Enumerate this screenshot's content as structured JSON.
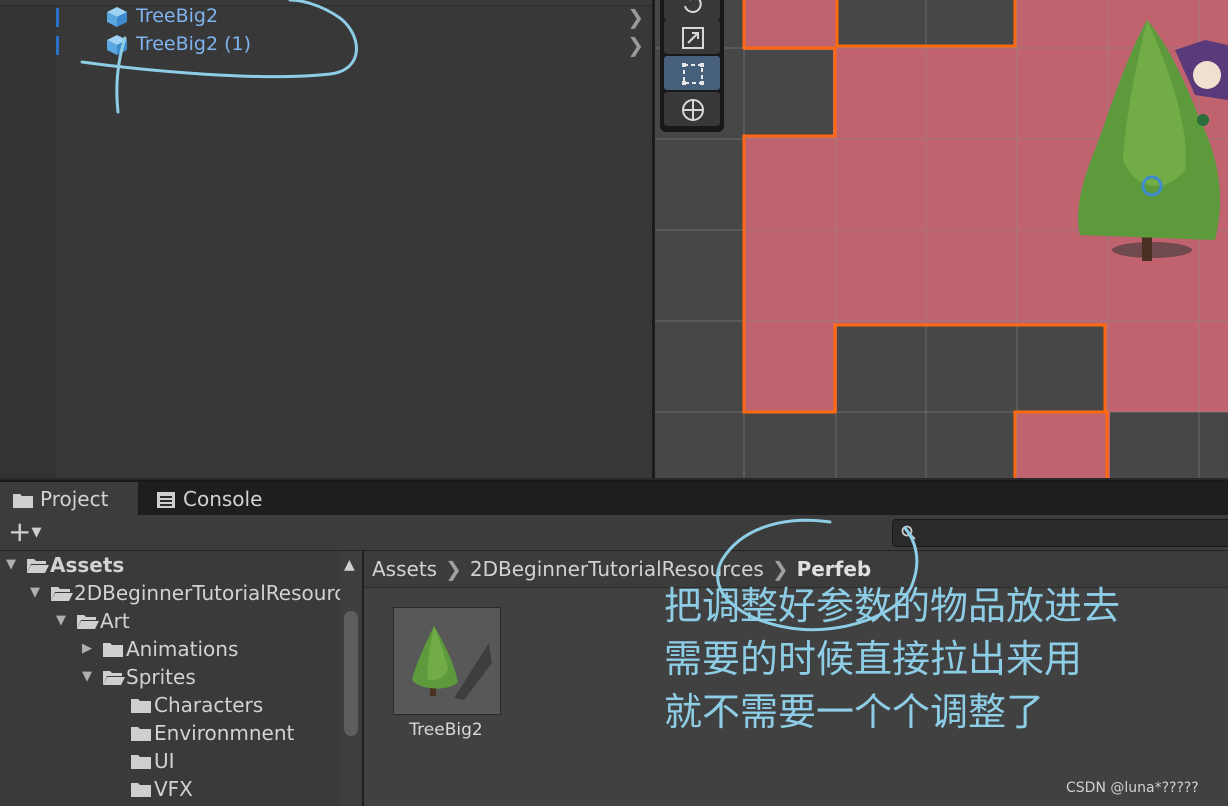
{
  "hierarchy": {
    "items": [
      {
        "label": "TreeBig2",
        "icon": "prefab-cube-icon"
      },
      {
        "label": "TreeBig2 (1)",
        "icon": "prefab-cube-icon"
      }
    ]
  },
  "scene": {
    "tools": [
      "rotate-tool-icon",
      "scale-tool-icon",
      "rect-tool-icon",
      "transform-tool-icon"
    ],
    "active_tool": "rect-tool-icon",
    "colors": {
      "tilemap_fill": "#c0636f",
      "tile_outline": "#ff6a10",
      "background": "#474747"
    }
  },
  "project_panel": {
    "tabs": [
      {
        "label": "Project",
        "icon": "folder-icon"
      },
      {
        "label": "Console",
        "icon": "console-icon"
      }
    ],
    "add_button": "+",
    "folder_tree": [
      {
        "label": "Assets",
        "expanded": true
      },
      {
        "label": "2DBeginnerTutorialResources",
        "expanded": true
      },
      {
        "label": "Art",
        "expanded": true
      },
      {
        "label": "Animations",
        "expanded": false
      },
      {
        "label": "Sprites",
        "expanded": true
      },
      {
        "label": "Characters"
      },
      {
        "label": "Environmnent"
      },
      {
        "label": "UI"
      },
      {
        "label": "VFX"
      }
    ],
    "breadcrumb": [
      "Assets",
      "2DBeginnerTutorialResources",
      "Perfeb"
    ],
    "assets": [
      {
        "label": "TreeBig2"
      }
    ]
  },
  "annotation": {
    "lines": [
      "把调整好参数的物品放进去",
      "需要的时候直接拉出来用",
      "就不需要一个个调整了"
    ],
    "color": "#8ecde6"
  },
  "watermark": "CSDN @luna*?????"
}
